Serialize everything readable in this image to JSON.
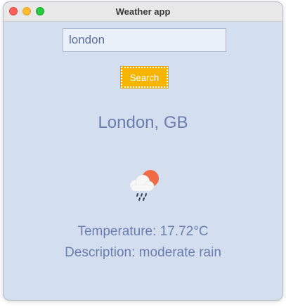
{
  "window": {
    "title": "Weather app"
  },
  "search": {
    "value": "london",
    "button_label": "Search"
  },
  "result": {
    "location": "London, GB",
    "icon": "cloud-sun-rain-icon",
    "temperature": "Temperature: 17.72°C",
    "description": "Description: moderate rain"
  },
  "colors": {
    "window_background": "#d3dfef",
    "button_background": "#f7b500",
    "text": "#6d7db0"
  }
}
